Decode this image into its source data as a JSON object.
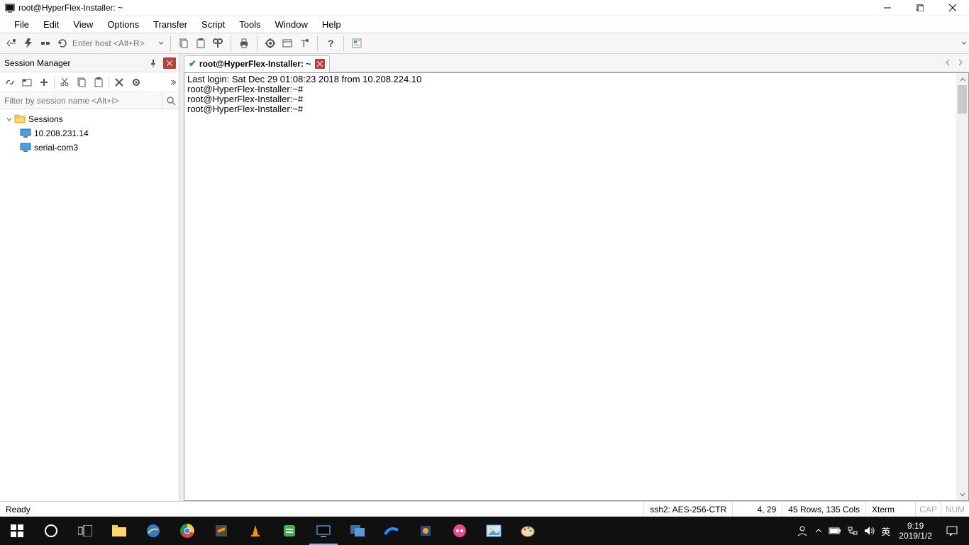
{
  "titlebar": {
    "title": "root@HyperFlex-Installer: ~"
  },
  "menu": [
    "File",
    "Edit",
    "View",
    "Options",
    "Transfer",
    "Script",
    "Tools",
    "Window",
    "Help"
  ],
  "host_input": {
    "placeholder": "Enter host <Alt+R>"
  },
  "session_manager": {
    "title": "Session Manager",
    "filter_placeholder": "Filter by session name <Alt+I>",
    "root_label": "Sessions",
    "items": [
      {
        "label": "10.208.231.14"
      },
      {
        "label": "serial-com3"
      }
    ]
  },
  "tab": {
    "title": "root@HyperFlex-Installer: ~"
  },
  "terminal_lines": [
    "Last login: Sat Dec 29 01:08:23 2018 from 10.208.224.10",
    "root@HyperFlex-Installer:~#",
    "root@HyperFlex-Installer:~#",
    "root@HyperFlex-Installer:~#"
  ],
  "statusbar": {
    "ready": "Ready",
    "protocol": "ssh2: AES-256-CTR",
    "cursor": "4,  29",
    "size": "45 Rows, 135 Cols",
    "emul": "Xterm",
    "cap": "CAP",
    "num": "NUM"
  },
  "taskbar": {
    "ime": "英",
    "time": "9:19",
    "date": "2019/1/2"
  }
}
